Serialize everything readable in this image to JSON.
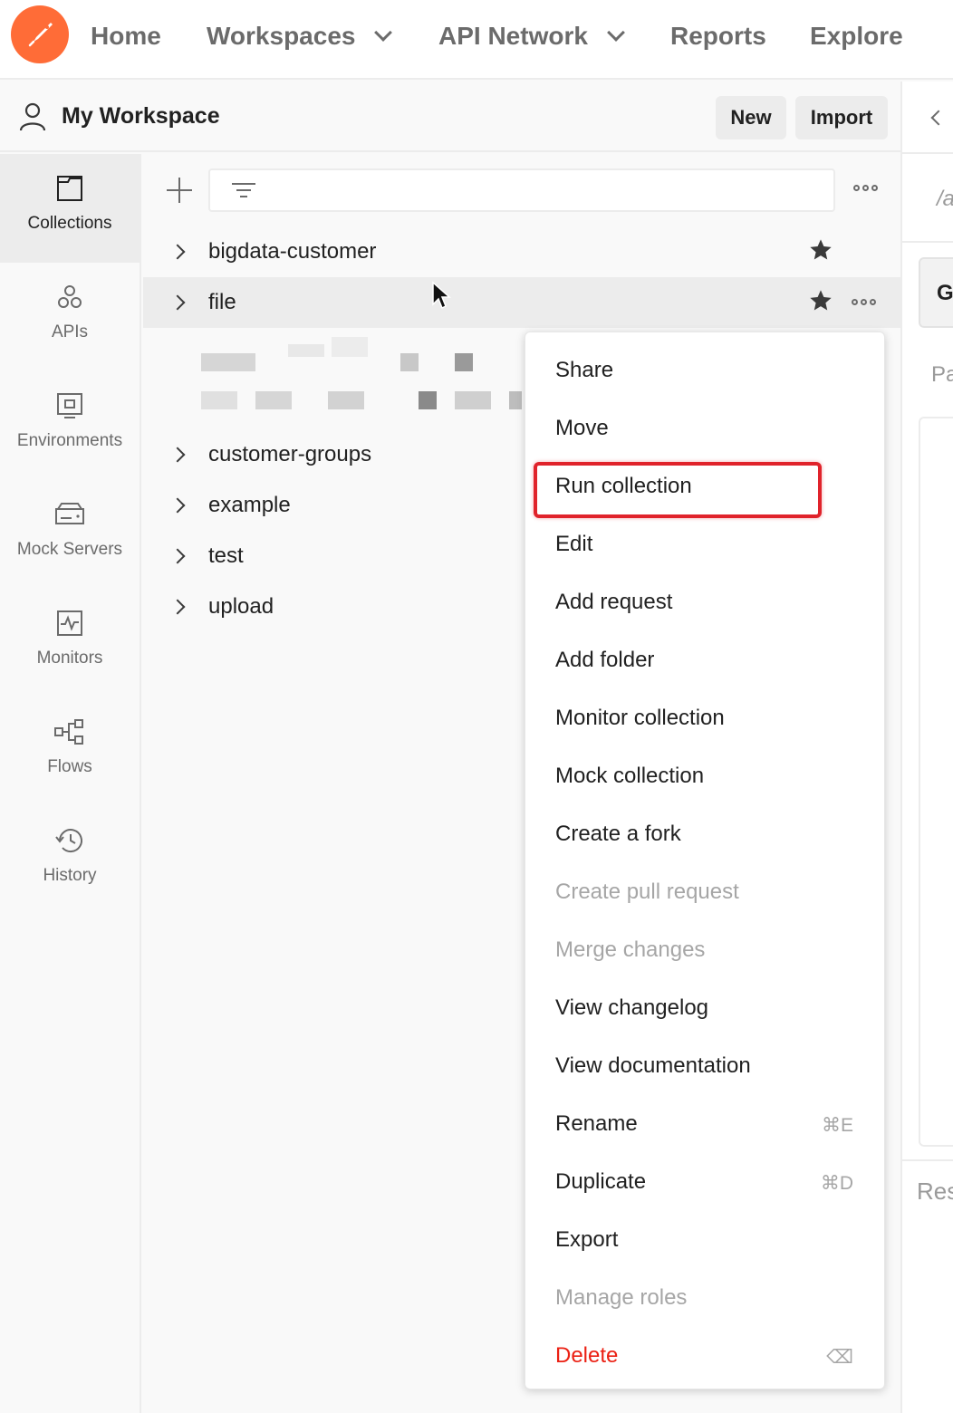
{
  "nav": {
    "home": "Home",
    "workspaces": "Workspaces",
    "api_network": "API Network",
    "reports": "Reports",
    "explore": "Explore"
  },
  "workspace": {
    "title": "My Workspace",
    "new_label": "New",
    "import_label": "Import"
  },
  "sidebar": {
    "items": [
      {
        "label": "Collections",
        "icon": "collections-icon",
        "active": true
      },
      {
        "label": "APIs",
        "icon": "apis-icon"
      },
      {
        "label": "Environments",
        "icon": "environments-icon"
      },
      {
        "label": "Mock Servers",
        "icon": "mock-servers-icon"
      },
      {
        "label": "Monitors",
        "icon": "monitors-icon"
      },
      {
        "label": "Flows",
        "icon": "flows-icon"
      },
      {
        "label": "History",
        "icon": "history-icon"
      }
    ]
  },
  "collections": [
    {
      "name": "bigdata-customer",
      "starred": true
    },
    {
      "name": "file",
      "starred": true
    },
    {
      "name": "customer-groups"
    },
    {
      "name": "example"
    },
    {
      "name": "test"
    },
    {
      "name": "upload"
    }
  ],
  "right_panel": {
    "path_text": "/a",
    "method_text": "G",
    "params_text": "Pa",
    "response_text": "Res"
  },
  "menu": {
    "items": [
      {
        "label": "Share"
      },
      {
        "label": "Move"
      },
      {
        "label": "Run collection",
        "highlighted": true
      },
      {
        "label": "Edit"
      },
      {
        "label": "Add request"
      },
      {
        "label": "Add folder"
      },
      {
        "label": "Monitor collection"
      },
      {
        "label": "Mock collection"
      },
      {
        "label": "Create a fork"
      },
      {
        "label": "Create pull request",
        "disabled": true
      },
      {
        "label": "Merge changes",
        "disabled": true
      },
      {
        "label": "View changelog"
      },
      {
        "label": "View documentation"
      },
      {
        "label": "Rename",
        "shortcut": "⌘E"
      },
      {
        "label": "Duplicate",
        "shortcut": "⌘D"
      },
      {
        "label": "Export"
      },
      {
        "label": "Manage roles",
        "disabled": true
      },
      {
        "label": "Delete",
        "danger": true,
        "shortcut": "⌫"
      }
    ]
  },
  "colors": {
    "brand": "#ff6c37",
    "highlight": "#e0232b",
    "danger": "#eb2013"
  }
}
